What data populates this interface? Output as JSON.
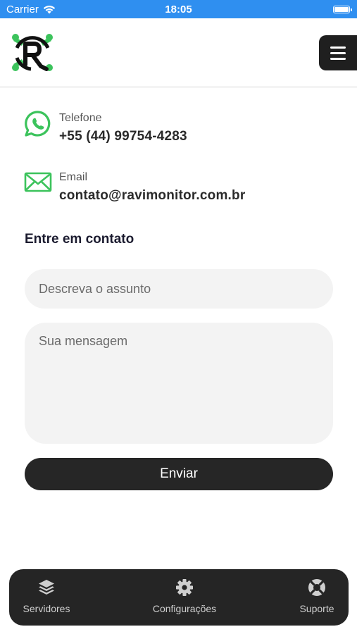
{
  "status_bar": {
    "carrier": "Carrier",
    "time": "18:05",
    "battery_level": 1.0,
    "background": "#2f8ff0"
  },
  "header": {
    "logo_icon": "ravi-monitor-logo",
    "menu_icon": "hamburger-menu-icon"
  },
  "contacts": [
    {
      "icon": "whatsapp-icon",
      "label": "Telefone",
      "value": "+55 (44) 99754-4283"
    },
    {
      "icon": "envelope-icon",
      "label": "Email",
      "value": "contato@ravimonitor.com.br"
    }
  ],
  "form": {
    "title": "Entre em contato",
    "subject_placeholder": "Descreva o assunto",
    "message_placeholder": "Sua mensagem",
    "send_label": "Enviar"
  },
  "tabbar": {
    "items": [
      {
        "icon": "layers-icon",
        "label": "Servidores"
      },
      {
        "icon": "gear-icon",
        "label": "Configurações"
      },
      {
        "icon": "lifebuoy-icon",
        "label": "Suporte"
      }
    ]
  },
  "colors": {
    "accent_green": "#3cc35c",
    "dark": "#1f1f1f",
    "field_bg": "#f3f3f3"
  }
}
